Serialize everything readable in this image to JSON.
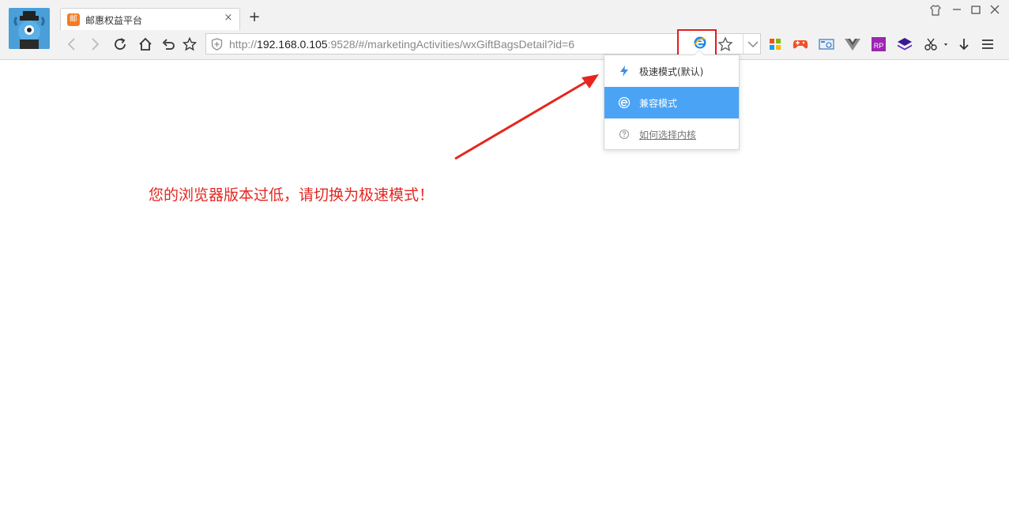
{
  "browser": {
    "tab": {
      "title": "邮惠权益平台",
      "favicon_text": "邮",
      "close_label": "×"
    },
    "new_tab_label": "+",
    "window_controls": {
      "skin_icon": "shirt-icon",
      "minimize_label": "—",
      "maximize_label": "☐",
      "close_label": "✕"
    },
    "toolbar": {
      "back_icon": "back-icon",
      "forward_icon": "forward-icon",
      "reload_icon": "reload-icon",
      "home_icon": "home-icon",
      "undo_icon": "undo-close-tab-icon",
      "favorite_icon": "star-icon"
    },
    "address": {
      "scheme": "http://",
      "host": "192.168.0.105",
      "rest": ":9528/#/marketingActivities/wxGiftBagsDetail?id=6"
    },
    "engine_button_icon": "ie-icon",
    "extensions": [
      "apps-icon",
      "game-icon",
      "screenshot-icon",
      "vue-icon",
      "axure-rp-icon",
      "layers-icon",
      "scissors-icon",
      "download-icon",
      "menu-icon"
    ]
  },
  "engine_menu": {
    "items": [
      {
        "label": "极速模式(默认)",
        "icon": "lightning-icon",
        "state": "normal"
      },
      {
        "label": "兼容模式",
        "icon": "ie-icon",
        "state": "selected"
      },
      {
        "label": "如何选择内核",
        "icon": "help-icon",
        "state": "link"
      }
    ]
  },
  "page": {
    "warning": "您的浏览器版本过低，请切换为极速模式！"
  },
  "annotation": {
    "colors": {
      "highlight": "#e11d1d",
      "warning": "#e5261f",
      "menu_active": "#4aa3f5"
    }
  }
}
